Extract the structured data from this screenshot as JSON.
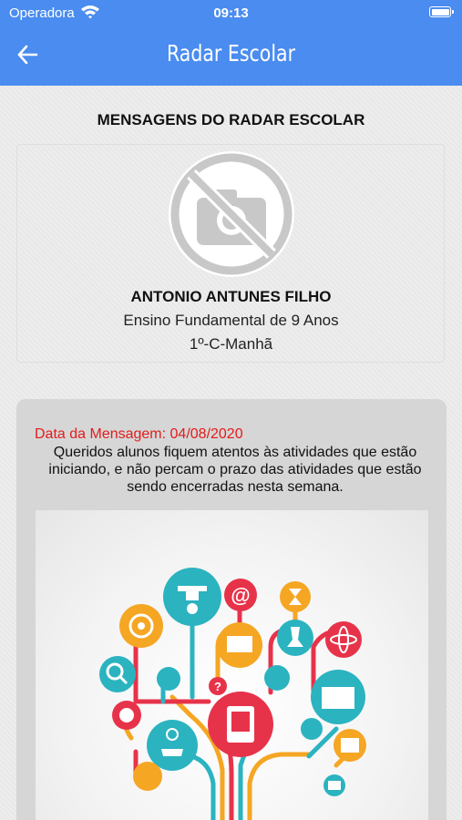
{
  "status_bar": {
    "carrier": "Operadora",
    "time": "09:13"
  },
  "nav": {
    "title": "Radar Escolar",
    "back_icon": "arrow-left-icon"
  },
  "page": {
    "heading": "MENSAGENS DO RADAR ESCOLAR"
  },
  "student": {
    "photo_icon": "no-photo-icon",
    "name": "ANTONIO ANTUNES FILHO",
    "level": "Ensino Fundamental de 9 Anos",
    "class": "1º-C-Manhã"
  },
  "message": {
    "date_label": "Data da Mensagem: 04/08/2020",
    "text": "Queridos alunos fiquem atentos às atividades que estão iniciando, e não percam o prazo das atividades que estão sendo encerradas nesta semana.",
    "image_icon": "education-network-illustration"
  },
  "colors": {
    "nav_bg": "#4a8cef",
    "date_text": "#e41b1b",
    "card_bg": "#d6d6d6"
  }
}
